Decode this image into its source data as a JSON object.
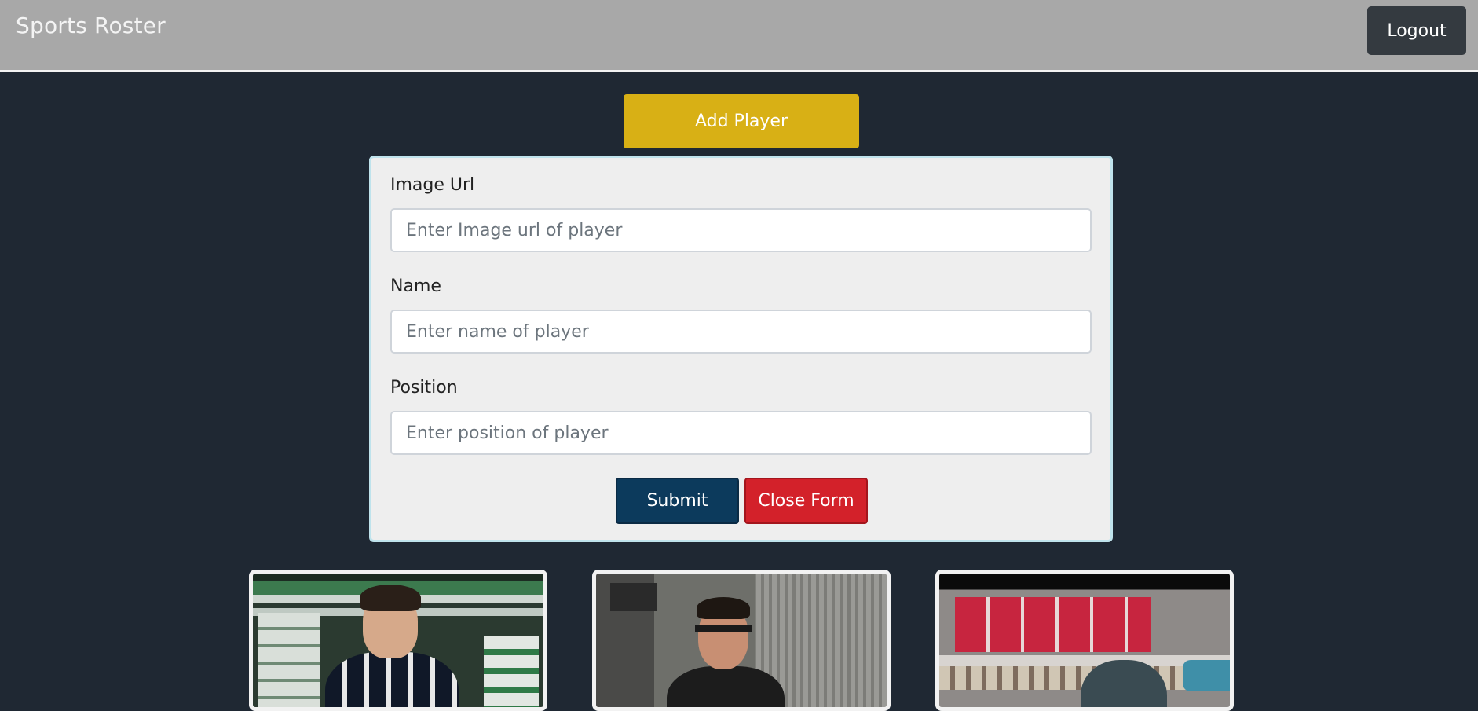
{
  "navbar": {
    "brand": "Sports Roster",
    "logout_label": "Logout"
  },
  "add_player_label": "Add Player",
  "form": {
    "image_url": {
      "label": "Image Url",
      "placeholder": "Enter Image url of player",
      "value": ""
    },
    "name": {
      "label": "Name",
      "placeholder": "Enter name of player",
      "value": ""
    },
    "position": {
      "label": "Position",
      "placeholder": "Enter position of player",
      "value": ""
    },
    "submit_label": "Submit",
    "close_label": "Close Form"
  },
  "colors": {
    "page_bg": "#1f2833",
    "navbar_bg": "#a8a8a8",
    "add_button": "#d8b015",
    "submit_button": "#0c3a5c",
    "close_button": "#d3212a",
    "logout_button": "#343a40"
  }
}
